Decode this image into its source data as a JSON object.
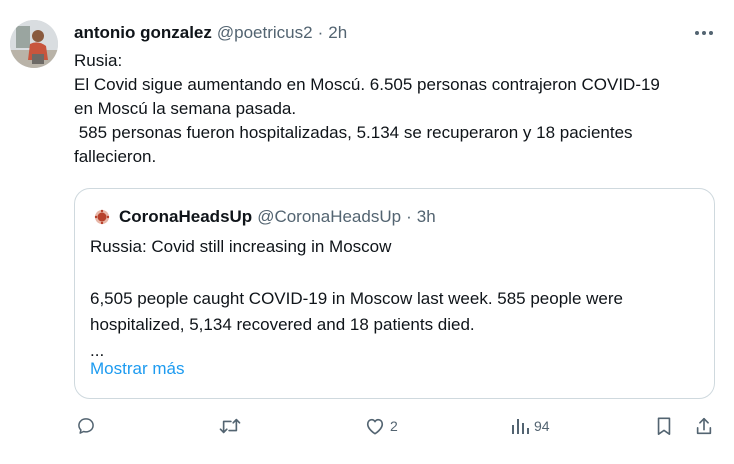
{
  "author": {
    "name": "antonio gonzalez",
    "handle": "@poetricus2",
    "separator": "·",
    "time": "2h"
  },
  "tweet": {
    "lines": [
      "Rusia:",
      "El Covid sigue aumentando en Moscú. 6.505 personas contrajeron COVID-19",
      "en Moscú la semana pasada.",
      " 585 personas fueron hospitalizadas, 5.134 se recuperaron y 18 pacientes",
      "fallecieron."
    ]
  },
  "quote": {
    "name": "CoronaHeadsUp",
    "handle": "@CoronaHeadsUp",
    "separator": "·",
    "time": "3h",
    "lines": [
      "Russia: Covid still increasing in Moscow",
      "",
      "6,505 people caught COVID-19 in Moscow last week. 585 people were",
      "hospitalized, 5,134 recovered and 18 patients died.",
      "..."
    ],
    "show_more": "Mostrar más"
  },
  "actions": {
    "reply_count": "",
    "retweet_count": "",
    "like_count": "2",
    "views_count": "94"
  },
  "icons": {
    "more": "more-horizontal-icon",
    "reply": "reply-icon",
    "retweet": "retweet-icon",
    "like": "heart-icon",
    "views": "views-icon",
    "bookmark": "bookmark-icon",
    "share": "share-icon"
  },
  "colors": {
    "text": "#0f1419",
    "secondary": "#536471",
    "link": "#1d9bf0",
    "border": "#cfd9de"
  }
}
